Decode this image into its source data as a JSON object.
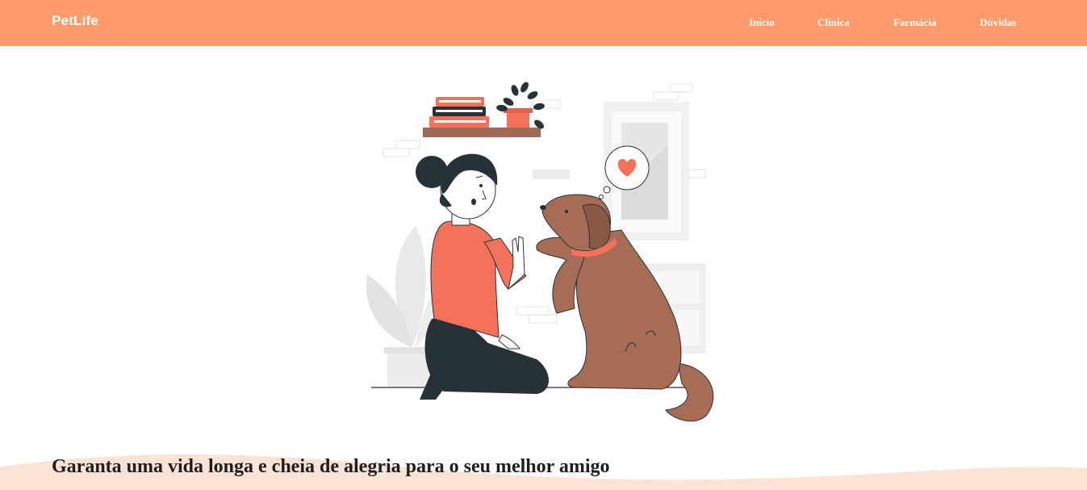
{
  "header": {
    "brand": "PetLife",
    "nav": [
      {
        "label": "Início"
      },
      {
        "label": "Clínica"
      },
      {
        "label": "Farmácia"
      },
      {
        "label": "Dúvidas"
      }
    ]
  },
  "hero": {
    "headline": "Garanta uma vida longa e cheia de alegria para o seu melhor amigo",
    "illustration": "woman-high-five-dog-illustration"
  },
  "colors": {
    "header_bg": "#ff9b6a",
    "accent": "#f4715a",
    "dog": "#a66c55",
    "text": "#1e1e1e"
  }
}
